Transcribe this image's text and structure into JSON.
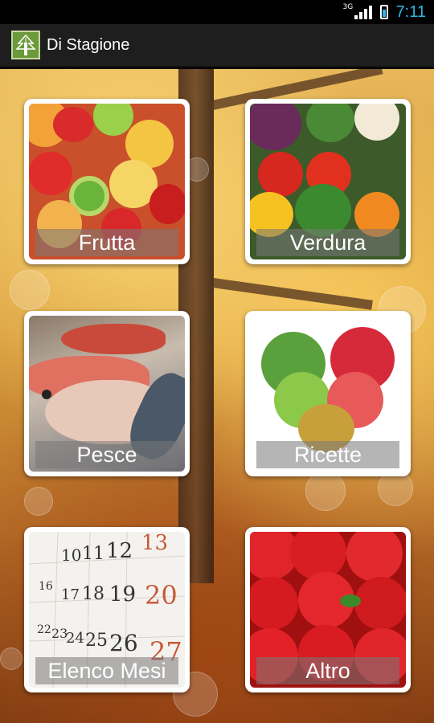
{
  "status_bar": {
    "network": "3G",
    "time": "7:11"
  },
  "action_bar": {
    "icon": "tree-icon",
    "title": "Di Stagione"
  },
  "tiles": [
    {
      "label": "Frutta",
      "image": "fruit-salad-photo"
    },
    {
      "label": "Verdura",
      "image": "vegetables-photo"
    },
    {
      "label": "Pesce",
      "image": "fish-photo"
    },
    {
      "label": "Ricette",
      "image": "vegetable-heart-photo"
    },
    {
      "label": "Elenco Mesi",
      "image": "calendar-photo"
    },
    {
      "label": "Altro",
      "image": "strawberries-photo"
    }
  ],
  "colors": {
    "accent": "#33b5e5",
    "action_bar": "#1e1e1e",
    "tile_border": "#ffffff"
  }
}
